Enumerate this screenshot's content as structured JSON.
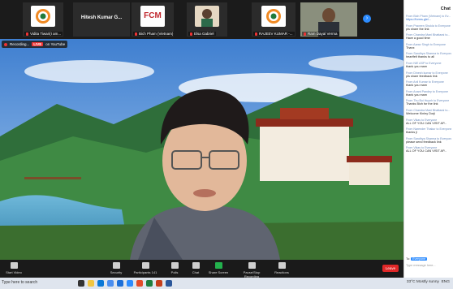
{
  "participants": [
    {
      "name": "Vidita Tiwari(I am...",
      "kind": "logo"
    },
    {
      "name": "Hitesh Kumar G...",
      "kind": "name"
    },
    {
      "name": "Bich Pham (Vietnam)",
      "kind": "fcm"
    },
    {
      "name": "Elsa Gabriel",
      "kind": "photo"
    },
    {
      "name": "RAJEEV KUMAR -...",
      "kind": "logo"
    },
    {
      "name": "Ram Dayal Verma",
      "kind": "video"
    }
  ],
  "fcm_logo": "FCM",
  "recording": {
    "label": "Recording...",
    "live": "LIVE",
    "platform": "on YouTube"
  },
  "toolbar": {
    "start_video": "Start Video",
    "security": "Security",
    "participants": "Participants",
    "participants_count": "141",
    "polls": "Polls",
    "chat": "Chat",
    "share_screen": "Share Screen",
    "pause_stop_recording": "Pause/Stop Recording",
    "reactions": "Reactions",
    "leave": "Leave"
  },
  "chat": {
    "title": "Chat",
    "messages": [
      {
        "from": "From Bich Pham (Vietnam) to Ev...",
        "text": "https://forms.gle/...",
        "link": true
      },
      {
        "from": "From Praveen Shukla to Everyone",
        "text": "pls share the link",
        "link": false
      },
      {
        "from": "From Chandra Mani Bhattarai to...",
        "text": "Have a good time",
        "link": false
      },
      {
        "from": "From Aarav Singh to Everyone",
        "text": "Thanx",
        "link": false
      },
      {
        "from": "From Sandhya Sharma to Everyone",
        "text": "heartfelt thanks to all",
        "link": false
      },
      {
        "from": "From NIE ASP to Everyone",
        "text": "thank you mam",
        "link": false
      },
      {
        "from": "From Dinesh kumar to Everyone",
        "text": "pls share feedback link",
        "link": false
      },
      {
        "from": "From Anil Kumar to Everyone",
        "text": "thank you mam",
        "link": false
      },
      {
        "from": "From Anant Pandey to Everyone",
        "text": "thank you mam",
        "link": false
      },
      {
        "from": "From Thu Bui Huynh to Everyone",
        "text": "Thanks Bich for the link",
        "link": false
      },
      {
        "from": "From Chandra Mani Bhattarai to...",
        "text": "Welcome Kinley Dorji",
        "link": false
      },
      {
        "from": "From Vikas to Everyone",
        "text": "ALL OF YOU CAN VISIT AP...",
        "link": false
      },
      {
        "from": "From Narender Thakur to Everyone",
        "text": "thanks ji",
        "link": false
      },
      {
        "from": "From Sandhya Sharma to Everyone",
        "text": "please send feedback link",
        "link": false
      },
      {
        "from": "From Vikas to Everyone",
        "text": "ALL OF YOU CAN VISIT AP...",
        "link": false
      }
    ],
    "to_label": "To:",
    "to_value": "Everyone",
    "input_placeholder": "Type message here..."
  },
  "taskbar": {
    "search": "Type here to search",
    "weather": "33°C Mostly sunny",
    "lang": "ENG"
  },
  "colors": {
    "accent": "#2d8cff",
    "leave": "#e02828",
    "share": "#23b14d"
  }
}
